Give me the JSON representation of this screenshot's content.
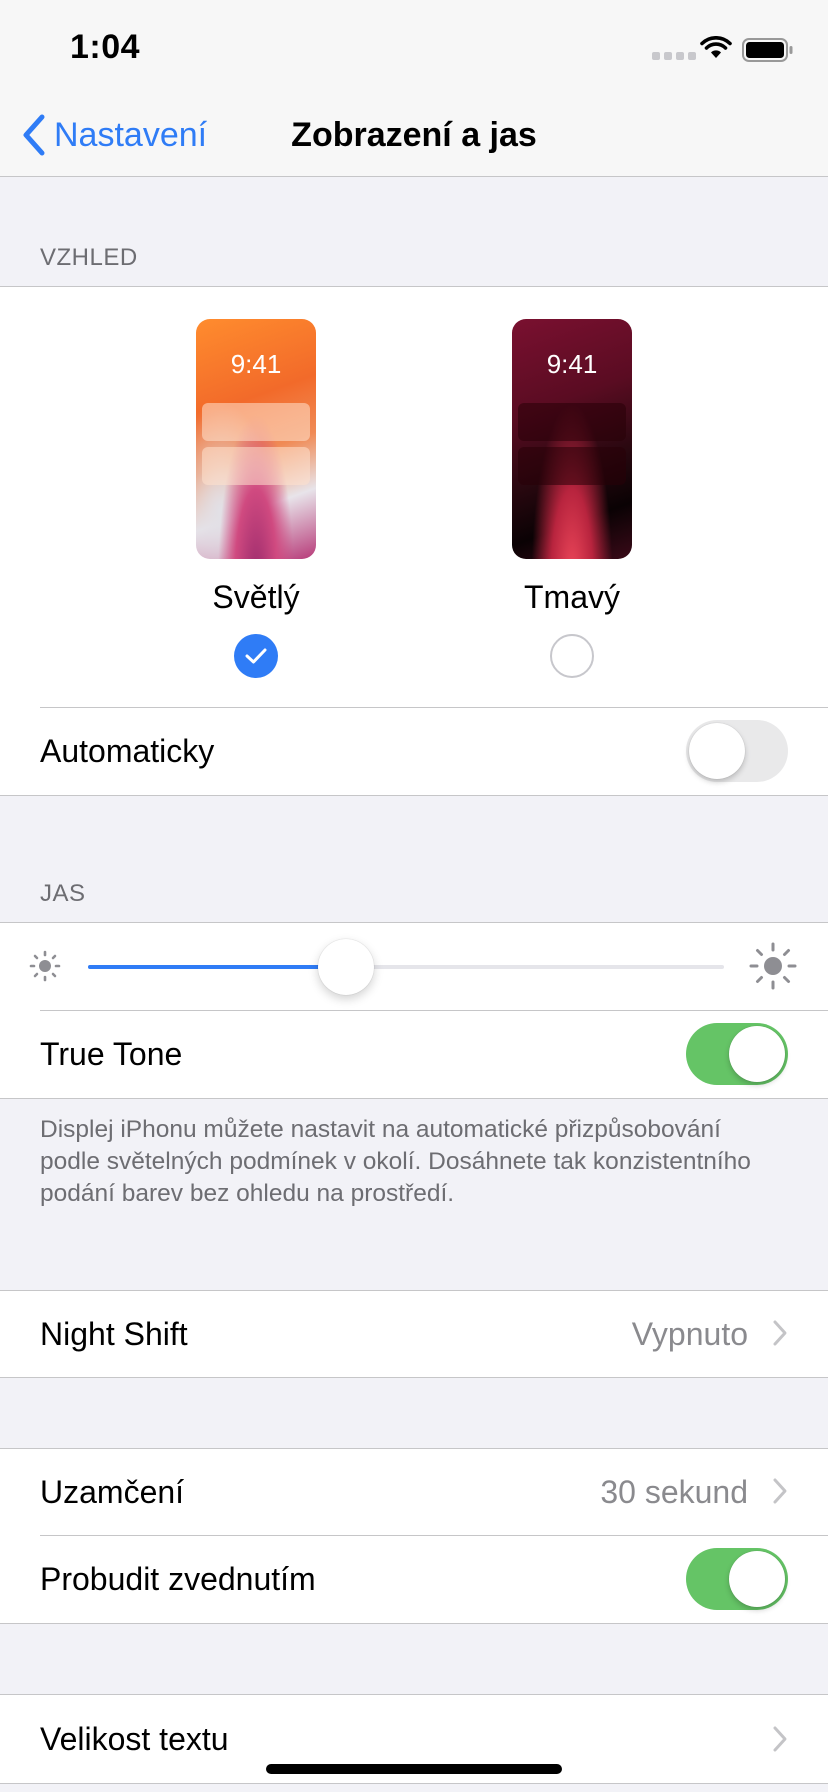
{
  "status_bar": {
    "time": "1:04",
    "signal_icon": "signal-dots-icon",
    "wifi_icon": "wifi-icon",
    "battery_icon": "battery-icon"
  },
  "nav": {
    "back_label": "Nastavení",
    "title": "Zobrazení a jas"
  },
  "appearance": {
    "header": "VZHLED",
    "light": {
      "label": "Světlý",
      "preview_time": "9:41",
      "selected": true
    },
    "dark": {
      "label": "Tmavý",
      "preview_time": "9:41",
      "selected": false
    },
    "automatic": {
      "label": "Automaticky",
      "enabled": false
    }
  },
  "brightness": {
    "header": "JAS",
    "level": 0.405,
    "true_tone": {
      "label": "True Tone",
      "enabled": true
    },
    "footer": "Displej iPhonu můžete nastavit na automatické přizpůsobování podle světelných podmínek v okolí. Dosáhnete tak konzistentního podání barev bez ohledu na prostředí."
  },
  "night_shift": {
    "label": "Night Shift",
    "value": "Vypnuto"
  },
  "lock": {
    "auto_lock": {
      "label": "Uzamčení",
      "value": "30 sekund"
    },
    "raise_to_wake": {
      "label": "Probudit zvednutím",
      "enabled": true
    }
  },
  "text_size": {
    "label": "Velikost textu"
  },
  "colors": {
    "accent": "#2f7cf6",
    "toggle_on": "#65c466",
    "background": "#f2f2f7"
  }
}
